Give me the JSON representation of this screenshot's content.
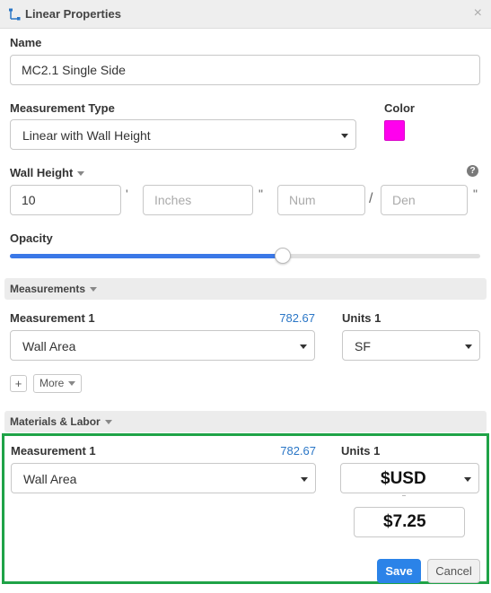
{
  "panel": {
    "title": "Linear Properties",
    "close": "×"
  },
  "name_field": {
    "label": "Name",
    "value": "MC2.1 Single Side"
  },
  "measurement_type": {
    "label": "Measurement Type",
    "selected": "Linear with Wall Height"
  },
  "color": {
    "label": "Color",
    "value": "#ff00ee"
  },
  "wall_height": {
    "label": "Wall Height",
    "help": "?",
    "feet_value": "10",
    "feet_mark": "'",
    "inches_placeholder": "Inches",
    "inches_mark": "\"",
    "num_placeholder": "Num",
    "fraction_sep": "/",
    "den_placeholder": "Den",
    "den_mark": "\""
  },
  "opacity": {
    "label": "Opacity",
    "value": 0.58
  },
  "measurements": {
    "header": "Measurements",
    "measurement_label": "Measurement 1",
    "measurement_value": "782.67",
    "measurement_selected": "Wall Area",
    "units_label": "Units 1",
    "units_selected": "SF",
    "add": "+",
    "more": "More"
  },
  "materials": {
    "header": "Materials & Labor",
    "measurement_label": "Measurement 1",
    "measurement_value": "782.67",
    "measurement_selected": "Wall Area",
    "units_label": "Units 1",
    "currency": "$USD",
    "price": "$7.25"
  },
  "buttons": {
    "save": "Save",
    "cancel": "Cancel"
  }
}
